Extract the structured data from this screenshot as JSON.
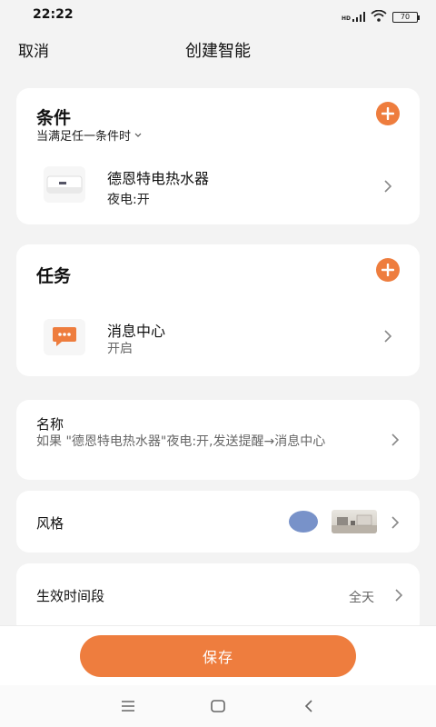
{
  "status": {
    "time": "22:22",
    "battery": "70",
    "signal_label": "HD",
    "signal_icon": "signal-icon",
    "wifi_icon": "wifi-icon",
    "battery_icon": "battery-icon"
  },
  "header": {
    "cancel": "取消",
    "title": "创建智能"
  },
  "conditions": {
    "heading": "条件",
    "mode": "当满足任一条件时",
    "add_icon": "plus-icon",
    "item": {
      "title": "德恩特电热水器",
      "subtitle": "夜电:开",
      "icon": "water-heater-icon"
    }
  },
  "tasks": {
    "heading": "任务",
    "add_icon": "plus-icon",
    "item": {
      "title": "消息中心",
      "subtitle": "开启",
      "icon": "message-icon"
    }
  },
  "name": {
    "label": "名称",
    "value": "如果 \"德恩特电热水器\"夜电:开,发送提醒→消息中心"
  },
  "style": {
    "label": "风格",
    "color": "#7892c9",
    "image": "room-image"
  },
  "period": {
    "label": "生效时间段",
    "value": "全天"
  },
  "save_label": "保存",
  "accent_color": "#ee7d3e",
  "navbar": {
    "menu_icon": "menu-icon",
    "home_icon": "home-icon",
    "back_icon": "back-icon"
  }
}
